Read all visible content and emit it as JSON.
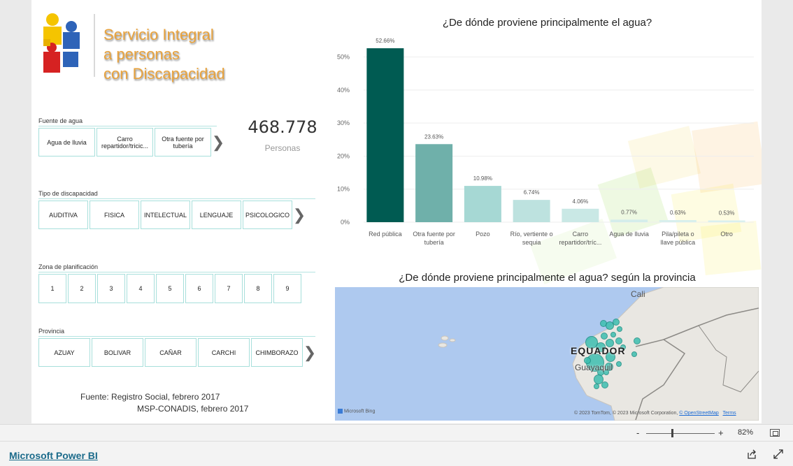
{
  "logo": {
    "text_line1": "Servicio Integral",
    "text_line2": "a personas",
    "text_line3": "con Discapacidad"
  },
  "slicers": {
    "fuente": {
      "title": "Fuente de agua",
      "items": [
        "Agua de lluvia",
        "Carro repartidor/tricic...",
        "Otra fuente por tubería"
      ]
    },
    "tipo": {
      "title": "Tipo de discapacidad",
      "items": [
        "AUDITIVA",
        "FISICA",
        "INTELECTUAL",
        "LENGUAJE",
        "PSICOLOGICO"
      ]
    },
    "zona": {
      "title": "Zona de planificación",
      "items": [
        "1",
        "2",
        "3",
        "4",
        "5",
        "6",
        "7",
        "8",
        "9"
      ]
    },
    "provincia": {
      "title": "Provincia",
      "items": [
        "AZUAY",
        "BOLIVAR",
        "CAÑAR",
        "CARCHI",
        "CHIMBORAZO"
      ]
    }
  },
  "kpi": {
    "value": "468.778",
    "label": "Personas"
  },
  "source": {
    "line1": "Fuente: Registro Social, febrero 2017",
    "line2": "MSP-CONADIS, febrero 2017"
  },
  "chart_data": {
    "type": "bar",
    "title": "¿De dónde proviene principalmente el agua?",
    "categories": [
      "Red pública",
      "Otra fuente por tubería",
      "Pozo",
      "Río, vertiente o sequia",
      "Carro repartidor/tríc...",
      "Agua de lluvia",
      "Pila/pileta o llave pública",
      "Otro"
    ],
    "category_lines": [
      [
        "Red pública"
      ],
      [
        "Otra fuente por",
        "tubería"
      ],
      [
        "Pozo"
      ],
      [
        "Río, vertiente o",
        "sequia"
      ],
      [
        "Carro",
        "repartidor/tríc..."
      ],
      [
        "Agua de lluvia"
      ],
      [
        "Pila/pileta o",
        "llave pública"
      ],
      [
        "Otro"
      ]
    ],
    "values": [
      52.66,
      23.63,
      10.98,
      6.74,
      4.06,
      0.77,
      0.63,
      0.53
    ],
    "data_labels": [
      "52.66%",
      "23.63%",
      "10.98%",
      "6.74%",
      "4.06%",
      "0.77%",
      "0.63%",
      "0.53%"
    ],
    "y_ticks": [
      0,
      10,
      20,
      30,
      40,
      50
    ],
    "y_tick_labels": [
      "0%",
      "10%",
      "20%",
      "30%",
      "40%",
      "50%"
    ],
    "ylim": [
      0,
      55
    ],
    "grid": true,
    "colors": [
      "#005b52",
      "#6fb0aa",
      "#a6d8d4",
      "#bde2df",
      "#c9e8e5",
      "#d4edeb",
      "#d8efed",
      "#daf0ee"
    ]
  },
  "map": {
    "title": "¿De dónde proviene principalmente el agua? según la provincia",
    "country_label": "EQUADOR",
    "city_cali": "Cali",
    "city_guayaquil": "Guayaquil",
    "bing_label": "Microsoft Bing",
    "attribution": "© 2023 TomTom, © 2023 Microsoft Corporation,",
    "osm": "© OpenStreetMap",
    "terms": "Terms",
    "ocean_color": "#aec9ef",
    "land_color": "#e9e7e2",
    "bubble_color": "#3dbfb0"
  },
  "zoom": {
    "minus": "-",
    "plus": "+",
    "level": "82%"
  },
  "footer": {
    "link": "Microsoft Power BI"
  }
}
